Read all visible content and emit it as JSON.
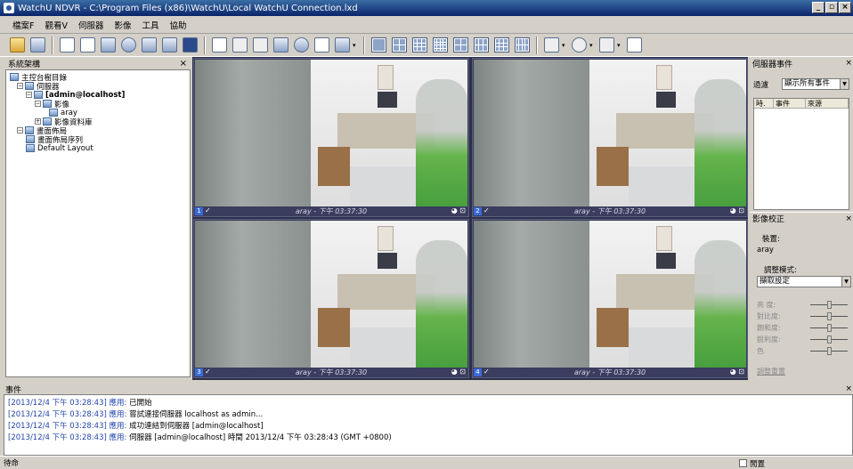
{
  "window": {
    "title": "WatchU NDVR - C:\\Program Files (x86)\\WatchU\\Local WatchU Connection.lxd",
    "buttons": [
      "_",
      "̱",
      "X"
    ]
  },
  "menu": [
    "檔案F",
    "觀看V",
    "伺服器",
    "影像",
    "工具",
    "協助"
  ],
  "tree": {
    "title": "系統架構",
    "close": "×",
    "items": [
      {
        "label": "主控台樹目錄",
        "level": 0,
        "bold": false,
        "expander": ""
      },
      {
        "label": "伺服器",
        "level": 1,
        "bold": false,
        "expander": "−"
      },
      {
        "label": "[admin@localhost]",
        "level": 2,
        "bold": true,
        "expander": "−"
      },
      {
        "label": "影像",
        "level": 3,
        "bold": false,
        "expander": "−"
      },
      {
        "label": "aray",
        "level": 4,
        "bold": false,
        "expander": ""
      },
      {
        "label": "影像資料庫",
        "level": 3,
        "bold": false,
        "expander": "+"
      },
      {
        "label": "畫面佈局",
        "level": 1,
        "bold": false,
        "expander": "−"
      },
      {
        "label": "畫面佈局序列",
        "level": 2,
        "bold": false,
        "expander": ""
      },
      {
        "label": "Default Layout",
        "level": 2,
        "bold": false,
        "expander": ""
      }
    ]
  },
  "cameras": [
    {
      "num": "1",
      "label": "aray - 下午 03:37:30"
    },
    {
      "num": "2",
      "label": "aray - 下午 03:37:30"
    },
    {
      "num": "3",
      "label": "aray - 下午 03:37:30"
    },
    {
      "num": "4",
      "label": "aray - 下午 03:37:30"
    }
  ],
  "server_events": {
    "title": "伺服器事件",
    "filter_label": "過濾",
    "filter_value": "顯示所有事件",
    "columns": [
      "時.",
      "事件",
      "來源"
    ]
  },
  "adjust": {
    "title": "影像校正",
    "device_label": "裝置:",
    "device_value": "aray",
    "mode_label": "調整模式:",
    "mode_value": "擷取設定",
    "sliders": [
      {
        "label": "亮 度:",
        "level": 0.5
      },
      {
        "label": "對比度:",
        "level": 0.5
      },
      {
        "label": "飽和度:",
        "level": 0.5
      },
      {
        "label": "銳利度:",
        "level": 0.5
      },
      {
        "label": "色",
        "level": 0.5
      }
    ],
    "reset": "調整重置"
  },
  "events": {
    "title": "事件",
    "lines": [
      {
        "ts": "[2013/12/4 下午 03:28:43]",
        "src": "應用:",
        "msg": "已開始"
      },
      {
        "ts": "[2013/12/4 下午 03:28:43]",
        "src": "應用:",
        "msg": "嘗試連接伺服器 localhost as admin..."
      },
      {
        "ts": "[2013/12/4 下午 03:28:43]",
        "src": "應用:",
        "msg": "成功連結到伺服器 [admin@localhost]"
      },
      {
        "ts": "[2013/12/4 下午 03:28:43]",
        "src": "應用:",
        "msg": "伺服器 [admin@localhost] 時間 2013/12/4 下午 03:28:43 (GMT +0800)"
      }
    ]
  },
  "status": {
    "left": "待命",
    "right": "閒置"
  }
}
